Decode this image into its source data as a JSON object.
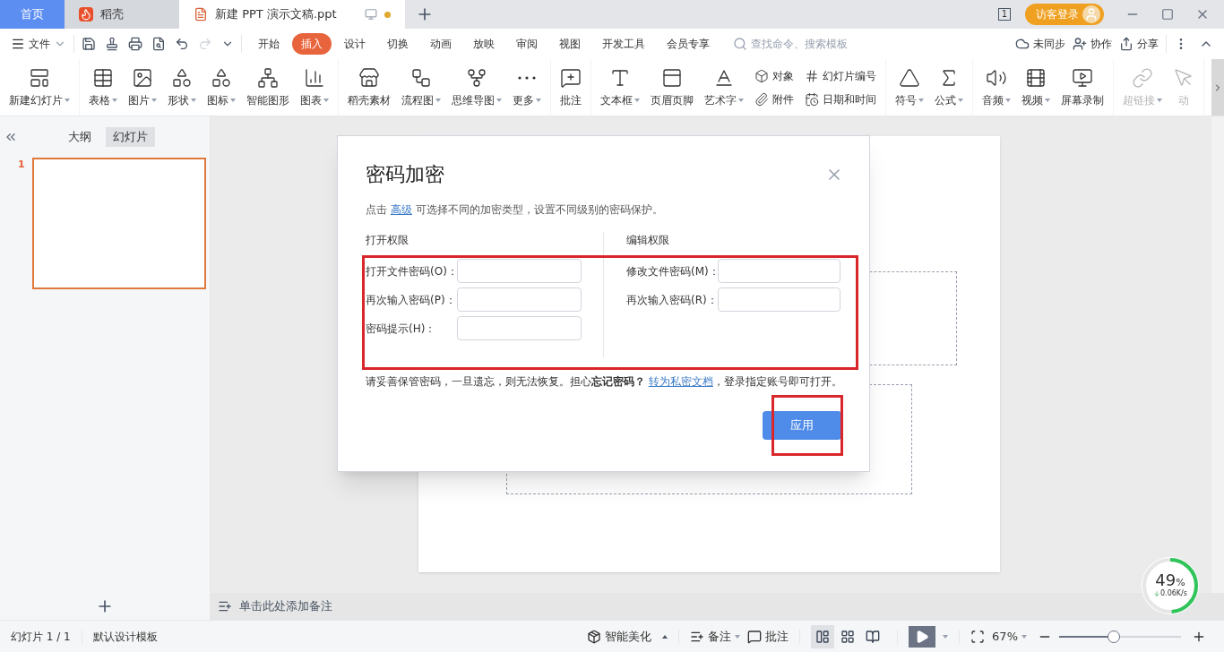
{
  "tabs": [
    {
      "label": "首页",
      "kind": "home",
      "selected": false
    },
    {
      "label": "稻壳",
      "kind": "docer",
      "selected": false
    },
    {
      "label": "新建 PPT 演示文稿.ppt",
      "kind": "doc",
      "selected": true
    }
  ],
  "title_bar": {
    "window_count": "1",
    "login": "访客登录"
  },
  "menu": {
    "file": "文件",
    "tabs": [
      {
        "label": "开始",
        "selected": false
      },
      {
        "label": "插入",
        "selected": true
      },
      {
        "label": "设计",
        "selected": false
      },
      {
        "label": "切换",
        "selected": false
      },
      {
        "label": "动画",
        "selected": false
      },
      {
        "label": "放映",
        "selected": false
      },
      {
        "label": "审阅",
        "selected": false
      },
      {
        "label": "视图",
        "selected": false
      },
      {
        "label": "开发工具",
        "selected": false
      },
      {
        "label": "会员专享",
        "selected": false
      }
    ],
    "search": {
      "placeholder": "查找命令、搜索模板"
    },
    "actions": [
      "未同步",
      "协作",
      "分享"
    ]
  },
  "ribbon_groups": [
    [
      {
        "kind": "large",
        "label": "新建幻灯片",
        "dropdown": true,
        "disabled": false
      }
    ],
    [
      {
        "kind": "large",
        "label": "表格",
        "dropdown": true,
        "disabled": false
      },
      {
        "kind": "large",
        "label": "图片",
        "dropdown": true,
        "disabled": false
      },
      {
        "kind": "large",
        "label": "形状",
        "dropdown": true,
        "disabled": false
      },
      {
        "kind": "large",
        "label": "图标",
        "dropdown": true,
        "disabled": false
      },
      {
        "kind": "large",
        "label": "智能图形",
        "dropdown": false,
        "disabled": false
      },
      {
        "kind": "large",
        "label": "图表",
        "dropdown": true,
        "disabled": false
      }
    ],
    [
      {
        "kind": "large",
        "label": "稻壳素材",
        "dropdown": false,
        "disabled": false
      },
      {
        "kind": "large",
        "label": "流程图",
        "dropdown": true,
        "disabled": false
      },
      {
        "kind": "large",
        "label": "思维导图",
        "dropdown": true,
        "disabled": false
      },
      {
        "kind": "large",
        "label": "更多",
        "dropdown": true,
        "disabled": false
      }
    ],
    [
      {
        "kind": "large",
        "label": "批注",
        "dropdown": false,
        "disabled": false
      }
    ],
    [
      {
        "kind": "large",
        "label": "文本框",
        "dropdown": true,
        "disabled": false
      },
      {
        "kind": "large",
        "label": "页眉页脚",
        "dropdown": false,
        "disabled": false
      },
      {
        "kind": "large",
        "label": "艺术字",
        "dropdown": true,
        "disabled": false
      },
      {
        "kind": "pair",
        "items": [
          "对象",
          "附件"
        ]
      },
      {
        "kind": "pair",
        "items": [
          "幻灯片编号",
          "日期和时间"
        ]
      }
    ],
    [
      {
        "kind": "large",
        "label": "符号",
        "dropdown": true,
        "disabled": false
      },
      {
        "kind": "large",
        "label": "公式",
        "dropdown": true,
        "disabled": false
      }
    ],
    [
      {
        "kind": "large",
        "label": "音频",
        "dropdown": true,
        "disabled": false
      },
      {
        "kind": "large",
        "label": "视频",
        "dropdown": true,
        "disabled": false
      },
      {
        "kind": "large",
        "label": "屏幕录制",
        "dropdown": false,
        "disabled": false
      }
    ],
    [
      {
        "kind": "large",
        "label": "超链接",
        "dropdown": true,
        "disabled": true
      },
      {
        "kind": "large",
        "label": "动",
        "dropdown": false,
        "disabled": true
      }
    ]
  ],
  "side_panel": {
    "views": [
      {
        "label": "大纲",
        "selected": false
      },
      {
        "label": "幻灯片",
        "selected": true
      }
    ],
    "slides": [
      {
        "number": "1",
        "selected": true
      }
    ]
  },
  "notes": {
    "placeholder": "单击此处添加备注"
  },
  "dialog": {
    "title": "密码加密",
    "intro_before": "点击",
    "intro_link": "高级",
    "intro_after": "可选择不同的加密类型，设置不同级别的密码保护。",
    "sections": [
      {
        "heading": "打开权限",
        "fields": [
          "打开文件密码(O)：",
          "再次输入密码(P)：",
          "密码提示(H)："
        ]
      },
      {
        "heading": "编辑权限",
        "fields": [
          "修改文件密码(M)：",
          "再次输入密码(R)："
        ]
      }
    ],
    "warning_before": "请妥善保管密码，一旦遗忘，则无法恢复。担心**忘记密码？**",
    "warning_link": "转为私密文档",
    "warning_after": "，登录指定账号即可打开。",
    "apply": "应用"
  },
  "status_bar": {
    "slide": "幻灯片 1 / 1",
    "template": "默认设计模板",
    "beautify": "智能美化",
    "notes": "备注",
    "comment": "批注",
    "views": [
      {
        "kind": "normal",
        "selected": true
      },
      {
        "kind": "sorter",
        "selected": false
      },
      {
        "kind": "reading",
        "selected": false
      }
    ],
    "zoom": "67%",
    "zoom_slider": {
      "level": 0.45
    }
  },
  "net_widget": {
    "percent": "49",
    "unit": "%",
    "speed": "0.06K/s",
    "level": 0.49
  }
}
